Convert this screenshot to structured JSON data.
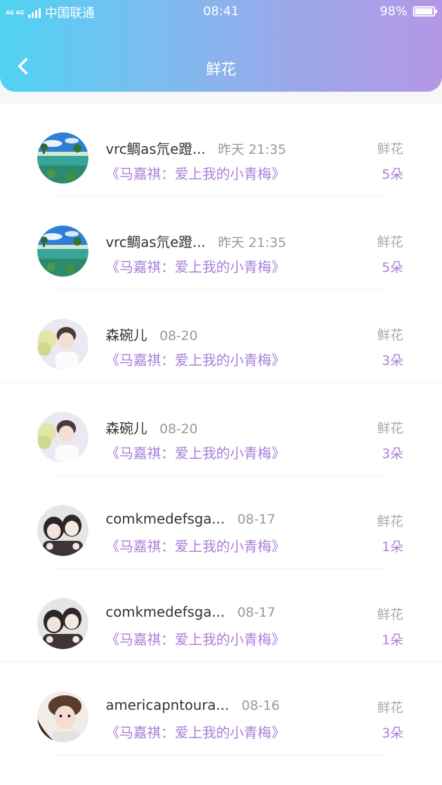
{
  "status_bar": {
    "network": "4G 4G",
    "carrier": "中国联通",
    "time": "08:41",
    "battery": "98%",
    "battery_level": 0.98
  },
  "nav": {
    "back_icon": "chevron-left-icon",
    "title": "鲜花"
  },
  "colors": {
    "header_gradient": [
      "#4fd2f2",
      "#b497e6"
    ],
    "accent_purple": "#a97fd9",
    "name_text": "#333333",
    "muted_text": "#999999"
  },
  "records": [
    {
      "name": "vrc鲷as氘e蹬...",
      "time": "昨天 21:35",
      "book": "《马嘉祺：爱上我的小青梅》",
      "gift_label": "鲜花",
      "gift_count": "5朵",
      "avatar": "beach-island-avatar"
    },
    {
      "name": "vrc鲷as氘e蹬...",
      "time": "昨天 21:35",
      "book": "《马嘉祺：爱上我的小青梅》",
      "gift_label": "鲜花",
      "gift_count": "5朵",
      "avatar": "beach-island-avatar"
    },
    {
      "name": "森碗儿",
      "time": "08-20",
      "book": "《马嘉祺：爱上我的小青梅》",
      "gift_label": "鲜花",
      "gift_count": "3朵",
      "avatar": "boy-portrait-avatar"
    },
    {
      "name": "森碗儿",
      "time": "08-20",
      "book": "《马嘉祺：爱上我的小青梅》",
      "gift_label": "鲜花",
      "gift_count": "3朵",
      "avatar": "boy-portrait-avatar"
    },
    {
      "name": "comkmedefsga...",
      "time": "08-17",
      "book": "《马嘉祺：爱上我的小青梅》",
      "gift_label": "鲜花",
      "gift_count": "1朵",
      "avatar": "two-girls-avatar"
    },
    {
      "name": "comkmedefsga...",
      "time": "08-17",
      "book": "《马嘉祺：爱上我的小青梅》",
      "gift_label": "鲜花",
      "gift_count": "1朵",
      "avatar": "two-girls-avatar"
    },
    {
      "name": "americapntoura...",
      "time": "08-16",
      "book": "《马嘉祺：爱上我的小青梅》",
      "gift_label": "鲜花",
      "gift_count": "3朵",
      "avatar": "selfie-avatar"
    }
  ]
}
